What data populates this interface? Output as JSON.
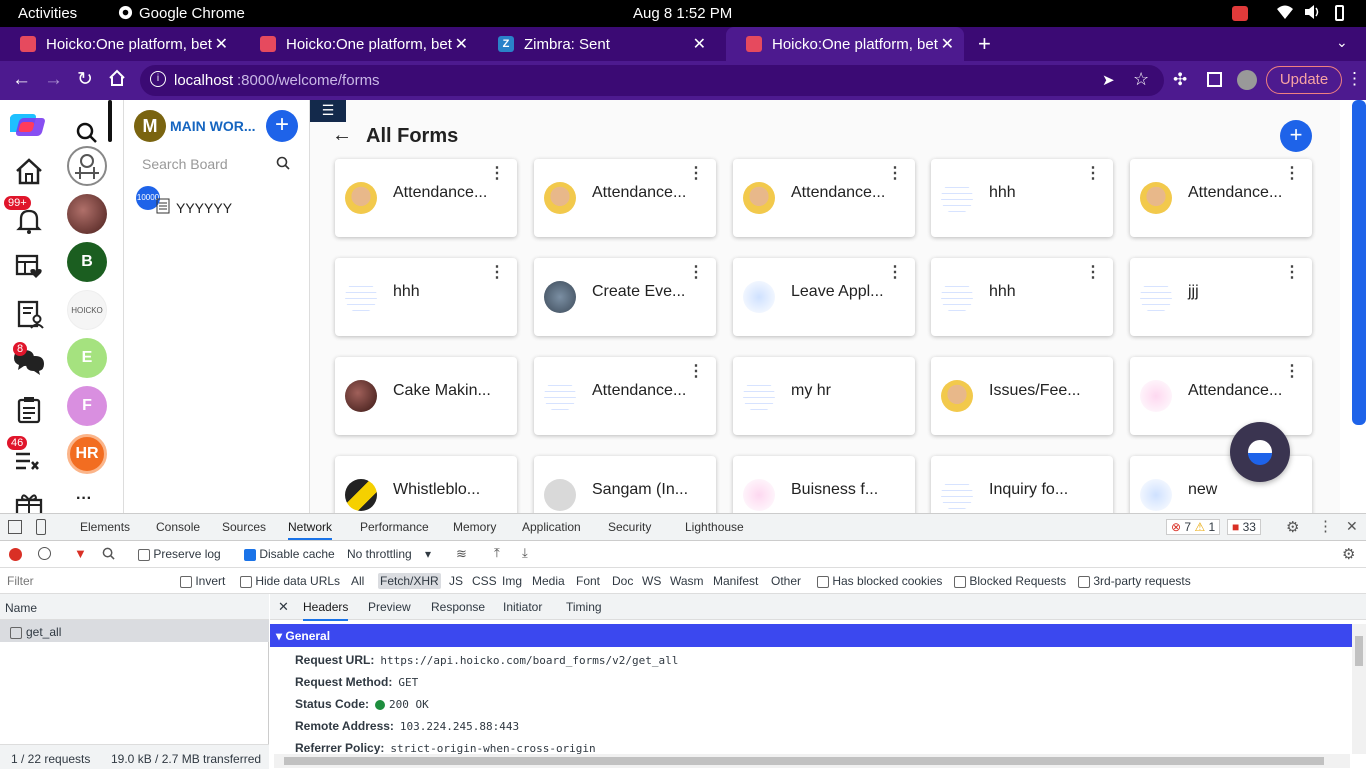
{
  "os_bar": {
    "activities": "Activities",
    "app_name": "Google Chrome",
    "datetime": "Aug 8   1:52 PM"
  },
  "tabs": [
    {
      "title": "Hoicko:One platform, bet",
      "color": "#e64a5e"
    },
    {
      "title": "Hoicko:One platform, bet",
      "color": "#e64a5e"
    },
    {
      "title": "Zimbra: Sent",
      "color": "#2a82c9"
    },
    {
      "title": "Hoicko:One platform, bet",
      "color": "#e64a5e"
    }
  ],
  "toolbar": {
    "url_host": "localhost",
    "url_path": ":8000/welcome/forms",
    "update_label": "Update"
  },
  "sidebar": {
    "notif_badge": "99+",
    "chat_badge": "8",
    "task_badge": "46",
    "more": "···"
  },
  "avatars": [
    {
      "letter": "B",
      "color": "#1b5e20"
    },
    {
      "letter": "HOICKO",
      "color": "#ffffff"
    },
    {
      "letter": "E",
      "color": "#a5e27f"
    },
    {
      "letter": "F",
      "color": "#d98fe0"
    },
    {
      "letter": "HR",
      "color": "#f26d21"
    }
  ],
  "board": {
    "workspace_letter": "M",
    "workspace_name": "MAIN WOR...",
    "search_placeholder": "Search Board",
    "item_badge": "10000",
    "item_name": "YYYYYY"
  },
  "main": {
    "title": "All Forms",
    "forms": [
      {
        "label": "Attendance...",
        "thumb": "face"
      },
      {
        "label": "Attendance...",
        "thumb": "face"
      },
      {
        "label": "Attendance...",
        "thumb": "face"
      },
      {
        "label": "hhh",
        "thumb": "doc"
      },
      {
        "label": "Attendance...",
        "thumb": "face"
      },
      {
        "label": "hhh",
        "thumb": "doc"
      },
      {
        "label": "Create Eve...",
        "thumb": "photo"
      },
      {
        "label": "Leave Appl...",
        "thumb": "people"
      },
      {
        "label": "hhh",
        "thumb": "doc"
      },
      {
        "label": "jjj",
        "thumb": "doc"
      },
      {
        "label": "Cake Makin...",
        "thumb": "cake"
      },
      {
        "label": "Attendance...",
        "thumb": "doc"
      },
      {
        "label": "my hr",
        "thumb": "doc"
      },
      {
        "label": "Issues/Fee...",
        "thumb": "face"
      },
      {
        "label": "Attendance...",
        "thumb": "lotus"
      },
      {
        "label": "Whistleblo...",
        "thumb": "sign"
      },
      {
        "label": "Sangam (In...",
        "thumb": "grey"
      },
      {
        "label": "Buisness f...",
        "thumb": "lotus"
      },
      {
        "label": "Inquiry fo...",
        "thumb": "doc"
      },
      {
        "label": "new",
        "thumb": "people"
      }
    ]
  },
  "devtools": {
    "tabs": [
      "Elements",
      "Console",
      "Sources",
      "Network",
      "Performance",
      "Memory",
      "Application",
      "Security",
      "Lighthouse"
    ],
    "active_tab": "Network",
    "errors": "7",
    "warnings": "1",
    "issues": "33",
    "preserve_log": "Preserve log",
    "disable_cache": "Disable cache",
    "throttling": "No throttling",
    "filter_placeholder": "Filter",
    "invert": "Invert",
    "hide_data_urls": "Hide data URLs",
    "type_filters": [
      "All",
      "Fetch/XHR",
      "JS",
      "CSS",
      "Img",
      "Media",
      "Font",
      "Doc",
      "WS",
      "Wasm",
      "Manifest",
      "Other"
    ],
    "has_blocked_cookies": "Has blocked cookies",
    "blocked_requests": "Blocked Requests",
    "third_party": "3rd-party requests",
    "name_header": "Name",
    "request_name": "get_all",
    "status_bar_requests": "1 / 22 requests",
    "status_bar_size": "19.0 kB / 2.7 MB transferred",
    "detail_tabs": [
      "Headers",
      "Preview",
      "Response",
      "Initiator",
      "Timing"
    ],
    "general_label": "General",
    "general": [
      {
        "key": "Request URL:",
        "value": "https://api.hoicko.com/board_forms/v2/get_all"
      },
      {
        "key": "Request Method:",
        "value": "GET"
      },
      {
        "key": "Status Code:",
        "value": "200 OK"
      },
      {
        "key": "Remote Address:",
        "value": "103.224.245.88:443"
      },
      {
        "key": "Referrer Policy:",
        "value": "strict-origin-when-cross-origin"
      }
    ]
  }
}
